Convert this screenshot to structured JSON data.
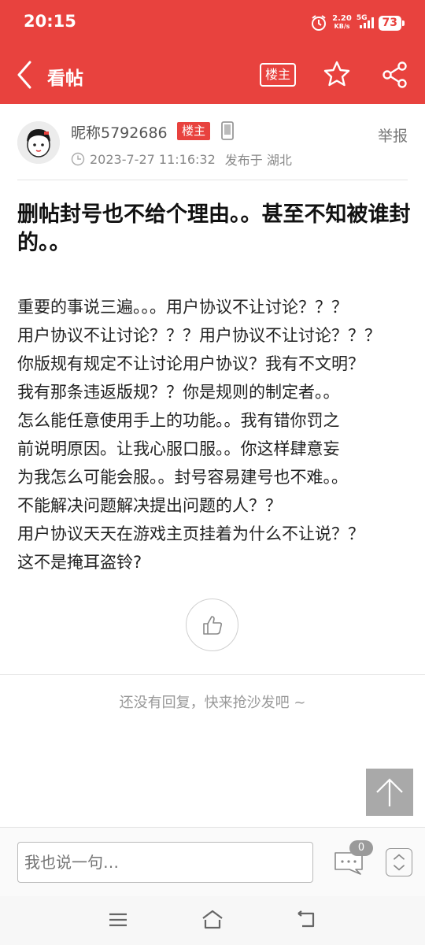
{
  "status_bar": {
    "time": "20:15",
    "net_speed_value": "2.20",
    "net_speed_unit": "KB/s",
    "network": "5G",
    "battery": "73",
    "icons": [
      "alarm-icon",
      "signal-icon"
    ]
  },
  "navbar": {
    "title": "看帖",
    "louzhu_button": "楼主",
    "icons": [
      "back-arrow-icon",
      "star-icon",
      "share-icon"
    ]
  },
  "post": {
    "author": {
      "nickname": "昵称5792686",
      "badge": "楼主",
      "device_icon": "phone-icon"
    },
    "timestamp": "2023-7-27 11:16:32",
    "location_label": "发布于 湖北",
    "report_label": "举报",
    "title": "删帖封号也不给个理由。。甚至不知被谁封的。。",
    "body_lines": [
      "重要的事说三遍。。。用户协议不让讨论？？？",
      "用户协议不让讨论？？？用户协议不让讨论？？？",
      "你版规有规定不让讨论用户协议？我有不文明？",
      "我有那条违返版规？？你是规则的制定者。。",
      "怎么能任意使用手上的功能。。我有错你罚之",
      "前说明原因。让我心服口服。。你这样肆意妄",
      "为我怎么可能会服。。封号容易建号也不难。。",
      "不能解决问题解决提出问题的人？？",
      "用户协议天天在游戏主页挂着为什么不让说？？",
      "这不是掩耳盗铃?"
    ]
  },
  "replies": {
    "empty_text": "还没有回复，快来抢沙发吧 ~"
  },
  "comment_bar": {
    "placeholder": "我也说一句…",
    "comment_count": "0"
  },
  "colors": {
    "brand_red": "#e8423e",
    "badge_gray": "#9a9a9a",
    "to_top_gray": "#a9a9a9"
  }
}
